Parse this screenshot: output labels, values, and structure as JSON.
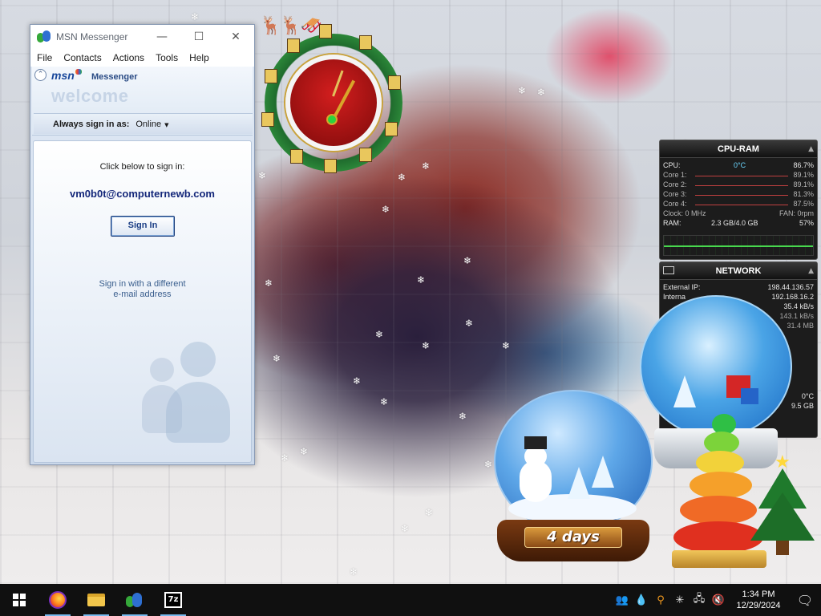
{
  "msn": {
    "window_title": "MSN Messenger",
    "menu": [
      "File",
      "Contacts",
      "Actions",
      "Tools",
      "Help"
    ],
    "logo_text": "msn",
    "product_text": "Messenger",
    "welcome_text": "welcome",
    "sign_in_as_label": "Always sign in as:",
    "status_value": "Online",
    "click_below_text": "Click below to sign in:",
    "email": "vm0b0t@computernewb.com",
    "sign_in_button": "Sign In",
    "different_email_line1": "Sign in with a different",
    "different_email_line2": "e-mail address"
  },
  "cpu_gadget": {
    "title": "CPU-RAM",
    "cpu_label": "CPU:",
    "cpu_temp": "0°C",
    "cpu_value": "86.7%",
    "cores": [
      {
        "label": "Core 1:",
        "value": "89.1%"
      },
      {
        "label": "Core 2:",
        "value": "89.1%"
      },
      {
        "label": "Core 3:",
        "value": "81.3%"
      },
      {
        "label": "Core 4:",
        "value": "87.5%"
      }
    ],
    "clock_text": "Clock: 0 MHz",
    "fan_text": "FAN: 0rpm",
    "ram_label": "RAM:",
    "ram_usage": "2.3 GB/4.0 GB",
    "ram_percent": "57%"
  },
  "net_gadget": {
    "title": "NETWORK",
    "external_ip_label": "External IP:",
    "external_ip": "198.44.136.57",
    "internal_ip_label": "Interna",
    "internal_ip": "192.168.16.2",
    "up_rate": "35.4 kB/s",
    "down_rate": "143.1 kB/s",
    "total": "31.4 MB",
    "extra_temp": "0°C",
    "extra_size": "9.5 GB"
  },
  "countdown": {
    "text": "4 days"
  },
  "taskbar": {
    "sevenzip_label": "7z",
    "time": "1:34 PM",
    "date": "12/29/2024"
  },
  "colors": {
    "taskbar_bg": "#101010",
    "msn_email": "#14277a",
    "gadget_bg": "#1c1c1c"
  }
}
